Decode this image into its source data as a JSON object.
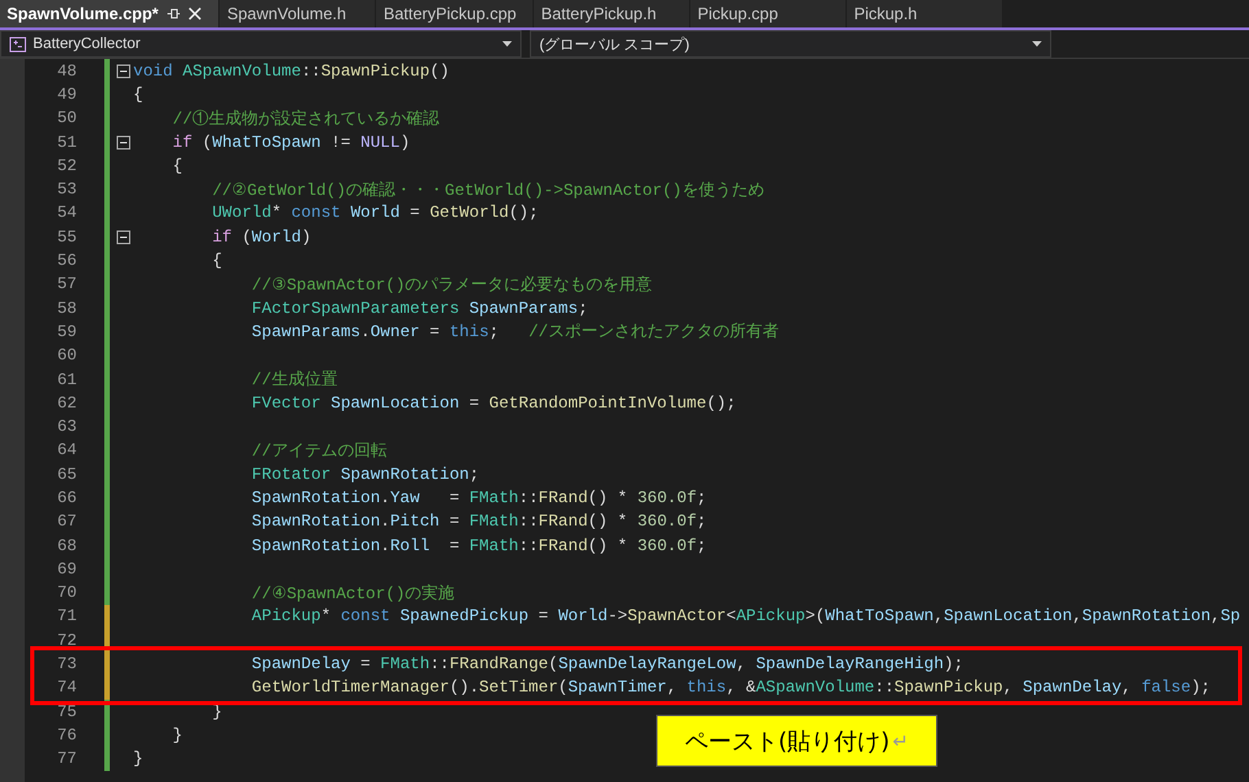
{
  "tabs": [
    {
      "label": "SpawnVolume.cpp*",
      "selected": true
    },
    {
      "label": "SpawnVolume.h",
      "selected": false
    },
    {
      "label": "BatteryPickup.cpp",
      "selected": false
    },
    {
      "label": "BatteryPickup.h",
      "selected": false
    },
    {
      "label": "Pickup.cpp",
      "selected": false
    },
    {
      "label": "Pickup.h",
      "selected": false
    }
  ],
  "nav_bar": {
    "project": "BatteryCollector",
    "scope": "(グローバル スコープ)"
  },
  "lines": [
    {
      "number": "48",
      "fold": true,
      "saved": true,
      "tokens": [
        {
          "kind": "kw",
          "t": "void"
        },
        {
          "kind": "type",
          "t": " ASpawnVolume"
        },
        {
          "kind": "pl",
          "t": "::"
        },
        {
          "kind": "fn",
          "t": "SpawnPickup"
        },
        {
          "kind": "pl",
          "t": "()"
        }
      ]
    },
    {
      "number": "49",
      "saved": true,
      "tokens": [
        {
          "kind": "pl",
          "t": "{"
        }
      ]
    },
    {
      "number": "50",
      "saved": true,
      "tokens": [
        {
          "kind": "cm",
          "t": "    //①生成物が設定されているか確認"
        }
      ]
    },
    {
      "number": "51",
      "fold": true,
      "saved": true,
      "tokens": [
        {
          "kind": "ctl",
          "t": "    if"
        },
        {
          "kind": "pl",
          "t": " ("
        },
        {
          "kind": "var",
          "t": "WhatToSpawn"
        },
        {
          "kind": "pl",
          "t": " != "
        },
        {
          "kind": "mac",
          "t": "NULL"
        },
        {
          "kind": "pl",
          "t": ")"
        }
      ]
    },
    {
      "number": "52",
      "saved": true,
      "tokens": [
        {
          "kind": "pl",
          "t": "    {"
        }
      ]
    },
    {
      "number": "53",
      "saved": true,
      "tokens": [
        {
          "kind": "cm",
          "t": "        //②GetWorld()の確認・・・GetWorld()->SpawnActor()を使うため"
        }
      ]
    },
    {
      "number": "54",
      "saved": true,
      "tokens": [
        {
          "kind": "type",
          "t": "        UWorld"
        },
        {
          "kind": "pl",
          "t": "* "
        },
        {
          "kind": "kw",
          "t": "const"
        },
        {
          "kind": "var",
          "t": " World"
        },
        {
          "kind": "pl",
          "t": " = "
        },
        {
          "kind": "fn",
          "t": "GetWorld"
        },
        {
          "kind": "pl",
          "t": "();"
        }
      ]
    },
    {
      "number": "55",
      "fold": true,
      "saved": true,
      "tokens": [
        {
          "kind": "ctl",
          "t": "        if"
        },
        {
          "kind": "pl",
          "t": " ("
        },
        {
          "kind": "var",
          "t": "World"
        },
        {
          "kind": "pl",
          "t": ")"
        }
      ]
    },
    {
      "number": "56",
      "saved": true,
      "tokens": [
        {
          "kind": "pl",
          "t": "        {"
        }
      ]
    },
    {
      "number": "57",
      "saved": true,
      "tokens": [
        {
          "kind": "cm",
          "t": "            //③SpawnActor()のパラメータに必要なものを用意"
        }
      ]
    },
    {
      "number": "58",
      "saved": true,
      "tokens": [
        {
          "kind": "type",
          "t": "            FActorSpawnParameters"
        },
        {
          "kind": "var",
          "t": " SpawnParams"
        },
        {
          "kind": "pl",
          "t": ";"
        }
      ]
    },
    {
      "number": "59",
      "saved": true,
      "tokens": [
        {
          "kind": "var",
          "t": "            SpawnParams"
        },
        {
          "kind": "pl",
          "t": "."
        },
        {
          "kind": "var",
          "t": "Owner"
        },
        {
          "kind": "pl",
          "t": " = "
        },
        {
          "kind": "kw",
          "t": "this"
        },
        {
          "kind": "pl",
          "t": ";"
        },
        {
          "kind": "cm",
          "t": "   //スポーンされたアクタの所有者"
        }
      ]
    },
    {
      "number": "60",
      "saved": true
    },
    {
      "number": "61",
      "saved": true,
      "tokens": [
        {
          "kind": "cm",
          "t": "            //生成位置"
        }
      ]
    },
    {
      "number": "62",
      "saved": true,
      "tokens": [
        {
          "kind": "type",
          "t": "            FVector"
        },
        {
          "kind": "var",
          "t": " SpawnLocation"
        },
        {
          "kind": "pl",
          "t": " = "
        },
        {
          "kind": "fn",
          "t": "GetRandomPointInVolume"
        },
        {
          "kind": "pl",
          "t": "();"
        }
      ]
    },
    {
      "number": "63",
      "saved": true
    },
    {
      "number": "64",
      "saved": true,
      "tokens": [
        {
          "kind": "cm",
          "t": "            //アイテムの回転"
        }
      ]
    },
    {
      "number": "65",
      "saved": true,
      "tokens": [
        {
          "kind": "type",
          "t": "            FRotator"
        },
        {
          "kind": "var",
          "t": " SpawnRotation"
        },
        {
          "kind": "pl",
          "t": ";"
        }
      ]
    },
    {
      "number": "66",
      "saved": true,
      "tokens": [
        {
          "kind": "var",
          "t": "            SpawnRotation"
        },
        {
          "kind": "pl",
          "t": "."
        },
        {
          "kind": "var",
          "t": "Yaw"
        },
        {
          "kind": "pl",
          "t": "   = "
        },
        {
          "kind": "type",
          "t": "FMath"
        },
        {
          "kind": "pl",
          "t": "::"
        },
        {
          "kind": "fn",
          "t": "FRand"
        },
        {
          "kind": "pl",
          "t": "() * "
        },
        {
          "kind": "num",
          "t": "360.0f"
        },
        {
          "kind": "pl",
          "t": ";"
        }
      ]
    },
    {
      "number": "67",
      "saved": true,
      "tokens": [
        {
          "kind": "var",
          "t": "            SpawnRotation"
        },
        {
          "kind": "pl",
          "t": "."
        },
        {
          "kind": "var",
          "t": "Pitch"
        },
        {
          "kind": "pl",
          "t": " = "
        },
        {
          "kind": "type",
          "t": "FMath"
        },
        {
          "kind": "pl",
          "t": "::"
        },
        {
          "kind": "fn",
          "t": "FRand"
        },
        {
          "kind": "pl",
          "t": "() * "
        },
        {
          "kind": "num",
          "t": "360.0f"
        },
        {
          "kind": "pl",
          "t": ";"
        }
      ]
    },
    {
      "number": "68",
      "saved": true,
      "tokens": [
        {
          "kind": "var",
          "t": "            SpawnRotation"
        },
        {
          "kind": "pl",
          "t": "."
        },
        {
          "kind": "var",
          "t": "Roll"
        },
        {
          "kind": "pl",
          "t": "  = "
        },
        {
          "kind": "type",
          "t": "FMath"
        },
        {
          "kind": "pl",
          "t": "::"
        },
        {
          "kind": "fn",
          "t": "FRand"
        },
        {
          "kind": "pl",
          "t": "() * "
        },
        {
          "kind": "num",
          "t": "360.0f"
        },
        {
          "kind": "pl",
          "t": ";"
        }
      ]
    },
    {
      "number": "69",
      "saved": true
    },
    {
      "number": "70",
      "saved": true,
      "tokens": [
        {
          "kind": "cm",
          "t": "            //④SpawnActor()の実施"
        }
      ]
    },
    {
      "number": "71",
      "saved": false,
      "tokens": [
        {
          "kind": "type",
          "t": "            APickup"
        },
        {
          "kind": "pl",
          "t": "* "
        },
        {
          "kind": "kw",
          "t": "const"
        },
        {
          "kind": "var",
          "t": " SpawnedPickup"
        },
        {
          "kind": "pl",
          "t": " = "
        },
        {
          "kind": "var",
          "t": "World"
        },
        {
          "kind": "pl",
          "t": "->"
        },
        {
          "kind": "fn",
          "t": "SpawnActor"
        },
        {
          "kind": "pl",
          "t": "<"
        },
        {
          "kind": "type",
          "t": "APickup"
        },
        {
          "kind": "pl",
          "t": ">("
        },
        {
          "kind": "var",
          "t": "WhatToSpawn"
        },
        {
          "kind": "pl",
          "t": ","
        },
        {
          "kind": "var",
          "t": "SpawnLocation"
        },
        {
          "kind": "pl",
          "t": ","
        },
        {
          "kind": "var",
          "t": "SpawnRotation"
        },
        {
          "kind": "pl",
          "t": ","
        },
        {
          "kind": "var",
          "t": "Sp"
        }
      ]
    },
    {
      "number": "72",
      "saved": false
    },
    {
      "number": "73",
      "saved": false,
      "tokens": [
        {
          "kind": "var",
          "t": "            SpawnDelay"
        },
        {
          "kind": "pl",
          "t": " = "
        },
        {
          "kind": "type",
          "t": "FMath"
        },
        {
          "kind": "pl",
          "t": "::"
        },
        {
          "kind": "fn",
          "t": "FRandRange"
        },
        {
          "kind": "pl",
          "t": "("
        },
        {
          "kind": "var",
          "t": "SpawnDelayRangeLow"
        },
        {
          "kind": "pl",
          "t": ", "
        },
        {
          "kind": "var",
          "t": "SpawnDelayRangeHigh"
        },
        {
          "kind": "pl",
          "t": ");"
        }
      ]
    },
    {
      "number": "74",
      "saved": false,
      "tokens": [
        {
          "kind": "fn",
          "t": "            GetWorldTimerManager"
        },
        {
          "kind": "pl",
          "t": "()."
        },
        {
          "kind": "fn",
          "t": "SetTimer"
        },
        {
          "kind": "pl",
          "t": "("
        },
        {
          "kind": "var",
          "t": "SpawnTimer"
        },
        {
          "kind": "pl",
          "t": ", "
        },
        {
          "kind": "kw",
          "t": "this"
        },
        {
          "kind": "pl",
          "t": ", &"
        },
        {
          "kind": "type",
          "t": "ASpawnVolume"
        },
        {
          "kind": "pl",
          "t": "::"
        },
        {
          "kind": "fn",
          "t": "SpawnPickup"
        },
        {
          "kind": "pl",
          "t": ", "
        },
        {
          "kind": "var",
          "t": "SpawnDelay"
        },
        {
          "kind": "pl",
          "t": ", "
        },
        {
          "kind": "kw",
          "t": "false"
        },
        {
          "kind": "pl",
          "t": ");"
        }
      ]
    },
    {
      "number": "75",
      "saved": true,
      "tokens": [
        {
          "kind": "pl",
          "t": "        }"
        }
      ]
    },
    {
      "number": "76",
      "saved": true,
      "tokens": [
        {
          "kind": "pl",
          "t": "    }"
        }
      ]
    },
    {
      "number": "77",
      "saved": true,
      "tokens": [
        {
          "kind": "pl",
          "t": "}"
        }
      ]
    }
  ],
  "callout": {
    "text": "ペースト(貼り付け)",
    "mark": "↵"
  }
}
